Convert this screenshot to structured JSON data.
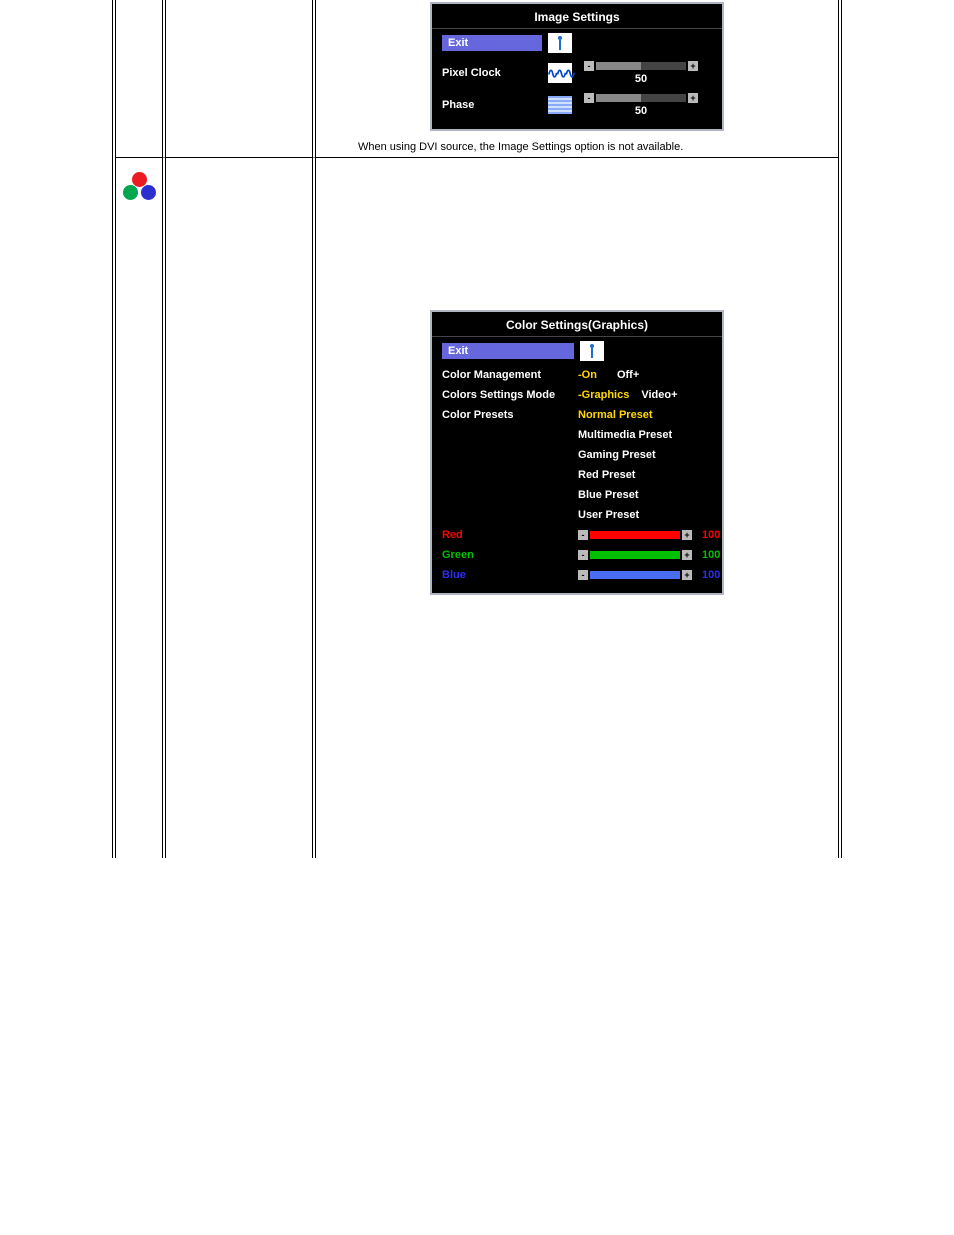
{
  "osd_image": {
    "title": "Image Settings",
    "exit": "Exit",
    "rows": {
      "pixel_clock": {
        "label": "Pixel Clock",
        "value": 50
      },
      "phase": {
        "label": "Phase",
        "value": 50
      }
    },
    "note": "When using  DVI source, the Image Settings option is not available."
  },
  "osd_color": {
    "title": "Color Settings(Graphics)",
    "exit": "Exit",
    "color_management": {
      "label": "Color Management",
      "on": "-On",
      "off": "Off+"
    },
    "mode": {
      "label": "Colors Settings Mode",
      "graphics": "-Graphics",
      "video": "Video+"
    },
    "presets": {
      "label": "Color Presets",
      "items": {
        "normal": "Normal Preset",
        "multimedia": "Multimedia Preset",
        "gaming": "Gaming Preset",
        "red": "Red Preset",
        "blue": "Blue Preset",
        "user": "User Preset"
      }
    },
    "rgb": {
      "red": {
        "label": "Red",
        "value": 100
      },
      "green": {
        "label": "Green",
        "value": 100
      },
      "blue": {
        "label": "Blue",
        "value": 100
      }
    }
  }
}
